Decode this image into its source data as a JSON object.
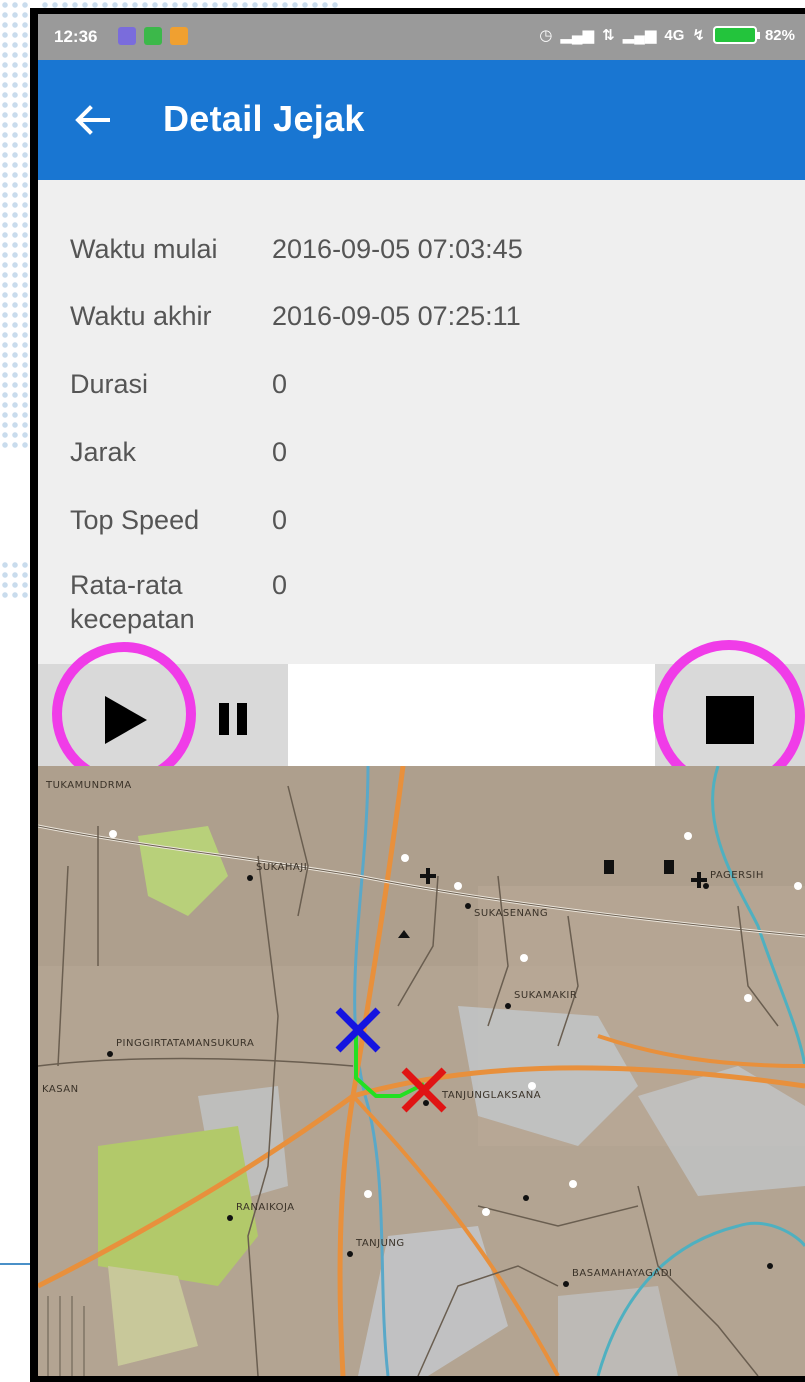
{
  "status_bar": {
    "time": "12:36",
    "network": "4G",
    "battery": "82%"
  },
  "app_bar": {
    "back_icon": "arrow-left-icon",
    "title": "Detail Jejak"
  },
  "details": [
    {
      "label": "Waktu mulai",
      "value": "2016-09-05 07:03:45"
    },
    {
      "label": "Waktu akhir",
      "value": "2016-09-05 07:25:11"
    },
    {
      "label": "Durasi",
      "value": "0"
    },
    {
      "label": "Jarak",
      "value": "0"
    },
    {
      "label": "Top Speed",
      "value": "0"
    },
    {
      "label": "Rata-rata\nkecepatan",
      "value": "0"
    }
  ],
  "controls": {
    "play_icon": "play-icon",
    "pause_icon": "pause-icon",
    "stop_icon": "stop-icon",
    "highlight_color": "#f03ce8"
  },
  "map": {
    "start_marker_color": "#1414e0",
    "end_marker_color": "#e01414",
    "track_color": "#22e022",
    "places": [
      "TUKAMUNDRMA",
      "SUKAHAJI",
      "SUKASENANG",
      "SUKAMAKIR",
      "PINGGIRTATAMANSUKURA",
      "KASAN",
      "TANJUNGLAKSANA",
      "RANAIKOJA",
      "TANJUNG",
      "BASAMAHAYAGADI",
      "PAGERSIH"
    ]
  },
  "colors": {
    "app_bar": "#1976d2",
    "status_bar": "#9a9a9a"
  }
}
